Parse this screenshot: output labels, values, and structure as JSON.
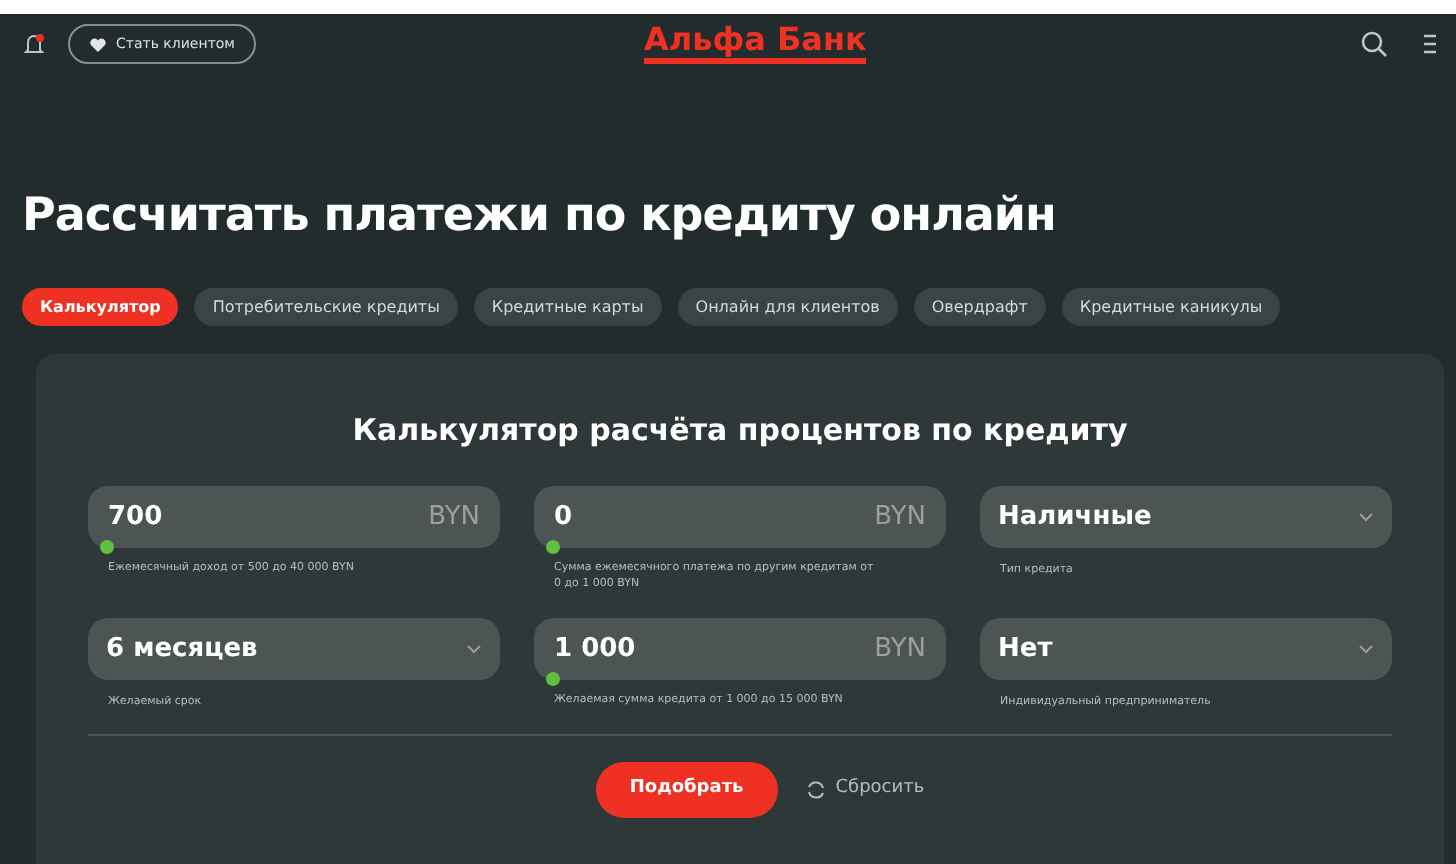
{
  "header": {
    "become_client": "Стать клиентом",
    "logo": "Альфа Банк"
  },
  "title": "Рассчитать платежи по кредиту онлайн",
  "tabs": [
    {
      "label": "Калькулятор",
      "selected": true
    },
    {
      "label": "Потребительские кредиты",
      "selected": false
    },
    {
      "label": "Кредитные карты",
      "selected": false
    },
    {
      "label": "Онлайн для клиентов",
      "selected": false
    },
    {
      "label": "Овердрафт",
      "selected": false
    },
    {
      "label": "Кредитные каникулы",
      "selected": false
    }
  ],
  "calculator": {
    "title": "Калькулятор расчёта процентов по кредиту",
    "fields": [
      {
        "kind": "amount",
        "value": "700",
        "currency": "BYN",
        "level": 0,
        "hint": "Ежемесячный доход от 500 до 40 000 BYN"
      },
      {
        "kind": "amount",
        "value": "0",
        "currency": "BYN",
        "level": 0,
        "hint": "Сумма ежемесячного платежа по другим кредитам от 0 до 1 000 BYN"
      },
      {
        "kind": "select",
        "value": "Наличные",
        "hint": "Тип кредита"
      },
      {
        "kind": "select",
        "value": "6 месяцев",
        "hint": "Желаемый срок"
      },
      {
        "kind": "amount",
        "value": "1 000",
        "currency": "BYN",
        "level": 0,
        "hint": "Желаемая сумма кредита от 1 000 до 15 000 BYN"
      },
      {
        "kind": "select",
        "value": "Нет",
        "hint": "Индивидуальный предприниматель"
      }
    ],
    "submit": "Подобрать",
    "reset": "Сбросить"
  }
}
